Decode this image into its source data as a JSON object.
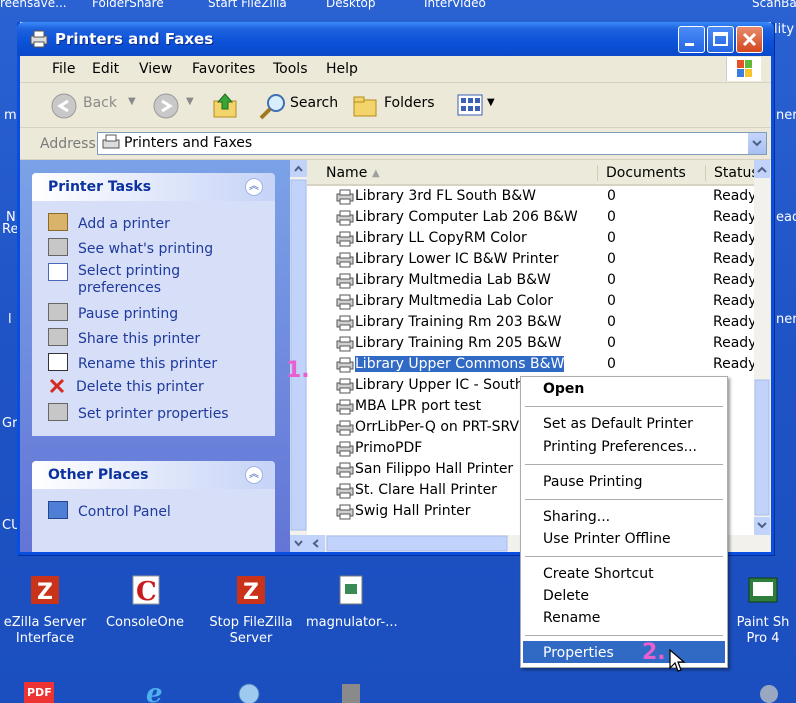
{
  "desktop": {
    "top_strip": [
      "reensave...",
      "FolderShare",
      "Start FileZilla",
      "Desktop",
      "InterVideo",
      "ScanBa"
    ],
    "right_partials": [
      "lity",
      "ner",
      "ead",
      "ner"
    ],
    "left_partials": [
      "m",
      "N",
      "Re",
      "l",
      "Gr",
      "CU"
    ],
    "icons": [
      {
        "label": "eZilla Server\nInterface",
        "icon": "filezilla-icon"
      },
      {
        "label": "ConsoleOne",
        "icon": "consoleone-icon"
      },
      {
        "label": "Stop FileZilla\nServer",
        "icon": "filezilla-icon"
      },
      {
        "label": "magnulator-...",
        "icon": "document-icon"
      },
      {
        "label": "Paint Sh\nPro 4",
        "icon": "paint-icon"
      }
    ],
    "bottom_icons": [
      "pdf-icon",
      "ie-icon",
      "network-icon",
      "tool-icon",
      "share-icon"
    ]
  },
  "window": {
    "title": "Printers and Faxes",
    "menu": [
      "File",
      "Edit",
      "View",
      "Favorites",
      "Tools",
      "Help"
    ],
    "toolbar": {
      "back": "Back",
      "search": "Search",
      "folders": "Folders"
    },
    "address": {
      "label": "Address",
      "value": "Printers and Faxes"
    },
    "printer_tasks": {
      "title": "Printer Tasks",
      "items": [
        "Add a printer",
        "See what's printing",
        "Select printing\npreferences",
        "Pause printing",
        "Share this printer",
        "Rename this printer",
        "Delete this printer",
        "Set printer properties"
      ]
    },
    "other_places": {
      "title": "Other Places",
      "items": [
        "Control Panel"
      ]
    },
    "columns": [
      "Name",
      "Documents",
      "Status"
    ],
    "rows": [
      {
        "name": "Library 3rd FL South B&W",
        "docs": "0",
        "status": "Ready"
      },
      {
        "name": "Library Computer Lab 206 B&W",
        "docs": "0",
        "status": "Ready"
      },
      {
        "name": "Library LL CopyRM Color",
        "docs": "0",
        "status": "Ready"
      },
      {
        "name": "Library Lower IC B&W Printer",
        "docs": "0",
        "status": "Ready"
      },
      {
        "name": "Library Multmedia Lab B&W",
        "docs": "0",
        "status": "Ready"
      },
      {
        "name": "Library Multmedia Lab Color",
        "docs": "0",
        "status": "Ready"
      },
      {
        "name": "Library Training Rm 203 B&W",
        "docs": "0",
        "status": "Ready"
      },
      {
        "name": "Library Training Rm 205 B&W",
        "docs": "0",
        "status": "Ready"
      },
      {
        "name": "Library Upper Commons B&W",
        "docs": "0",
        "status": "Ready"
      },
      {
        "name": "Library Upper IC - South B&",
        "docs": "",
        "status": "y"
      },
      {
        "name": "MBA LPR port test",
        "docs": "",
        "status": "y"
      },
      {
        "name": "OrrLibPer-Q on PRT-SRV3",
        "docs": "",
        "status": "y"
      },
      {
        "name": "PrimoPDF",
        "docs": "",
        "status": "y"
      },
      {
        "name": "San Filippo Hall Printer",
        "docs": "",
        "status": "y"
      },
      {
        "name": "St. Clare Hall Printer",
        "docs": "",
        "status": "y"
      },
      {
        "name": "Swig Hall Printer",
        "docs": "",
        "status": "y"
      }
    ]
  },
  "context_menu": {
    "items": [
      "Open",
      "Set as Default Printer",
      "Printing Preferences...",
      "Pause Printing",
      "Sharing...",
      "Use Printer Offline",
      "Create Shortcut",
      "Delete",
      "Rename",
      "Properties"
    ],
    "highlighted": "Properties"
  },
  "steps": [
    "1.",
    "2."
  ],
  "colors": {
    "accent": "#316ac5",
    "step": "#e85fcf",
    "desktop": "#1f56c9"
  }
}
